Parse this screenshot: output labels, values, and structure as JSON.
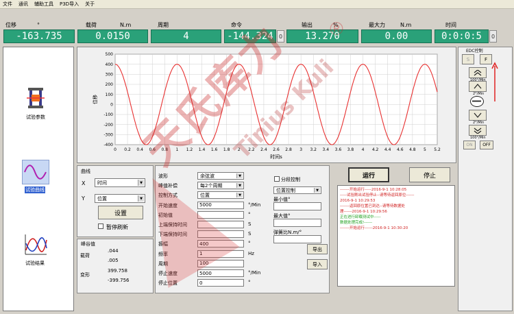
{
  "menu": [
    "文件",
    "通讯",
    "辅助工具",
    "P3D导入",
    "关于"
  ],
  "readouts": [
    {
      "label": "位移",
      "unit": "°",
      "value": "-163.735"
    },
    {
      "label": "载荷",
      "unit": "N.m",
      "value": "0.0150"
    },
    {
      "label": "周期",
      "unit": "",
      "value": "4"
    },
    {
      "label": "命令",
      "unit": "",
      "value": "-144.324"
    },
    {
      "label": "输出",
      "unit": "%",
      "value": "13.270"
    },
    {
      "label": "最大力",
      "unit": "N.m",
      "value": "0.00"
    },
    {
      "label": "时间",
      "unit": "",
      "value": "0:0:0:5"
    }
  ],
  "zero_label": "0",
  "sidebar": [
    {
      "label": "试验参数"
    },
    {
      "label": "试验曲线"
    },
    {
      "label": "试验结果"
    }
  ],
  "chart_data": {
    "type": "line",
    "xlabel": "时间s",
    "ylabel": "位移",
    "xlim": [
      0,
      5.2
    ],
    "ylim": [
      -400,
      500
    ],
    "xticks": [
      "0",
      "0.2",
      "0.4",
      "0.6",
      "0.8",
      "1",
      "1.2",
      "1.4",
      "1.6",
      "1.8",
      "2",
      "2.2",
      "2.4",
      "2.6",
      "2.8",
      "3",
      "3.2",
      "3.4",
      "3.6",
      "3.8",
      "4",
      "4.2",
      "4.4",
      "4.6",
      "4.8",
      "5",
      "5.2"
    ],
    "yticks": [
      "500",
      "400",
      "300",
      "200",
      "100",
      "0",
      "-100",
      "-200",
      "-300",
      "-400"
    ],
    "series": [
      {
        "amplitude": 400,
        "frequency": 1,
        "phase_deg": 90,
        "color": "#e83030"
      }
    ],
    "grid": true
  },
  "curve_group": {
    "title": "曲线",
    "x_label": "X",
    "x_value": "时间",
    "y_label": "Y",
    "y_value": "位置",
    "settings_btn": "设置",
    "pause_label": "暂停刷新"
  },
  "peak_group": {
    "title": "峰谷值",
    "rows": [
      {
        "label": "载荷",
        "v1": ".044",
        "v2": ".005"
      },
      {
        "label": "变形",
        "v1": "399.758",
        "v2": "-399.756"
      }
    ]
  },
  "waveform": {
    "rows": [
      {
        "label": "波形",
        "type": "select",
        "value": "余弦波",
        "unit": ""
      },
      {
        "label": "峰值补偿",
        "type": "select",
        "value": "每2个周期",
        "unit": ""
      },
      {
        "label": "控制方式",
        "type": "select",
        "value": "位置",
        "unit": ""
      },
      {
        "label": "开始速度",
        "type": "input",
        "value": "5000",
        "unit": "°/Min"
      },
      {
        "label": "初始值",
        "type": "input",
        "value": "",
        "unit": "°"
      },
      {
        "label": "上端保持时间",
        "type": "input",
        "value": "",
        "unit": "S"
      },
      {
        "label": "下端保持时间",
        "type": "input",
        "value": "",
        "unit": "S"
      },
      {
        "label": "振幅",
        "type": "input",
        "value": "400",
        "unit": "°"
      },
      {
        "label": "频率",
        "type": "input",
        "value": "1",
        "unit": "Hz"
      },
      {
        "label": "周期",
        "type": "input",
        "value": "100",
        "unit": ""
      },
      {
        "label": "停止速度",
        "type": "input",
        "value": "5000",
        "unit": "°/Min"
      },
      {
        "label": "停止位置",
        "type": "input",
        "value": "0",
        "unit": "°"
      }
    ]
  },
  "segment": {
    "checkbox_label": "分段控制",
    "mode_value": "位置控制",
    "min_label": "最小值°",
    "max_label": "最大值°",
    "stiffness_label": "弹簧比N.m/°",
    "export_btn": "导出",
    "import_btn": "导入"
  },
  "actions": {
    "run": "运行",
    "stop": "停止"
  },
  "log": [
    {
      "text": "-------开始运行-----2016-9-1 10:28:05",
      "color": "#d02020"
    },
    {
      "text": "-----试验刚出试验停止--请等待返回原位------",
      "color": "#d02020"
    },
    {
      "text": "2016-9-1 10:29:53",
      "color": "#d02020"
    },
    {
      "text": "-------返回原位置已到达--请等待数据处",
      "color": "#d02020"
    },
    {
      "text": "理------2016-9-1 10:29:56",
      "color": "#d02020"
    },
    {
      "text": "正在进行卸载测试中-----",
      "color": "#20a020"
    },
    {
      "text": "数据处理完成!------",
      "color": "#20a020"
    },
    {
      "text": "-------开始运行------2016-9-1 10:30:20",
      "color": "#d02020"
    }
  ],
  "edc": {
    "title": "EDC控制",
    "s_label": "S",
    "f_label": "F",
    "speed_up": "2°/Min",
    "speed_down": "2°/Min",
    "fast_up": "100°/Min",
    "fast_down": "100°/Min",
    "on_label": "ON",
    "off_label": "OFF"
  },
  "watermark": {
    "brand": "天氏库力",
    "latin": "Tinius Kuli",
    "reg": "®"
  },
  "colors": {
    "readout_bg": "#2aa179",
    "curve": "#e83030"
  }
}
